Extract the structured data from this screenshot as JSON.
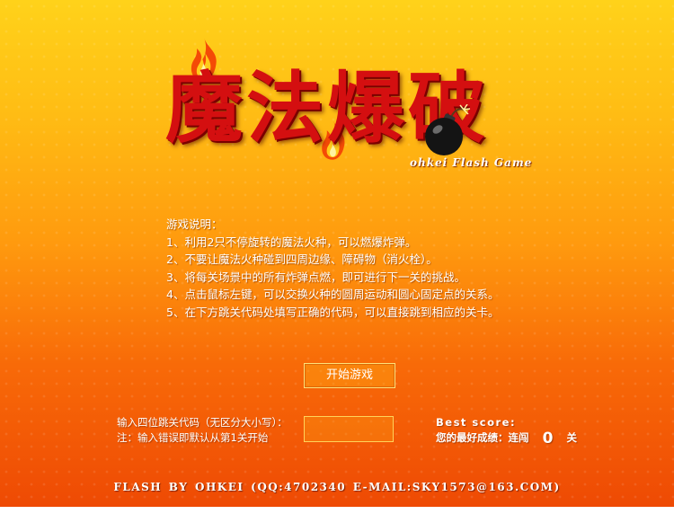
{
  "game": {
    "title": "魔法爆破",
    "subtitle": "ohkei Flash Game"
  },
  "instructions": {
    "heading": "游戏说明：",
    "items": [
      "1、利用2只不停旋转的魔法火种，可以燃爆炸弹。",
      "2、不要让魔法火种碰到四周边缘、障碍物（消火栓）。",
      "3、将每关场景中的所有炸弹点燃，即可进行下一关的挑战。",
      "4、点击鼠标左键，可以交换火种的圆周运动和圆心固定点的关系。",
      "5、在下方跳关代码处填写正确的代码，可以直接跳到相应的关卡。"
    ]
  },
  "start_button": {
    "label": "开始游戏"
  },
  "level_code": {
    "label_line1": "输入四位跳关代码（无区分大小写）：",
    "label_line2": "注：输入错误即默认从第1关开始",
    "value": ""
  },
  "best_score": {
    "heading": "Best score:",
    "prefix": "您的最好成绩：连闯",
    "value": "0",
    "suffix": "关"
  },
  "footer": {
    "text": "FLASH BY OHKEI  (QQ:4702340  E-MAIL:SKY1573@163.COM)"
  },
  "icons": [
    "flame-icon",
    "bomb-icon"
  ],
  "colors": {
    "title_red": "#d40f10",
    "bg_top": "#ffd21a",
    "bg_bottom": "#ee4a04"
  }
}
